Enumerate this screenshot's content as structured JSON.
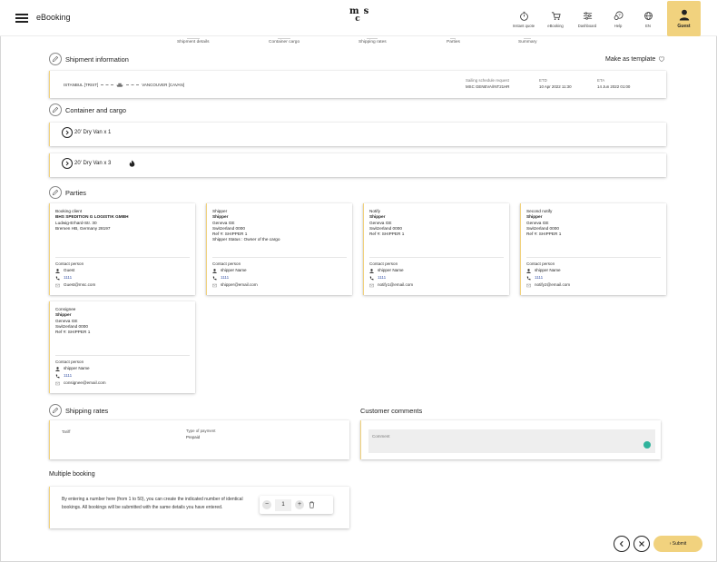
{
  "header": {
    "title": "eBooking",
    "logo_line1": "ms",
    "logo_line2": "c",
    "tools": [
      {
        "label": "Instant quote",
        "icon": "stopwatch-icon"
      },
      {
        "label": "eBooking",
        "icon": "cart-icon"
      },
      {
        "label": "Dashboard",
        "icon": "sliders-icon"
      },
      {
        "label": "Help",
        "icon": "help-chat-icon"
      },
      {
        "label": "EN",
        "icon": "globe-icon"
      }
    ],
    "user_label": "Guest"
  },
  "steps": [
    "Shipment details",
    "Container cargo",
    "Shipping rates",
    "Parties",
    "Summary"
  ],
  "shipment": {
    "heading": "Shipment information",
    "template_link": "Make as template",
    "origin": "ISTANBUL [TRIST]",
    "destination": "VANCOUVER [CAVAN]",
    "schedule_label": "Sailing schedule request",
    "schedule_value": "MSC GENEVA/INT21HR",
    "etd_label": "ETD",
    "etd_value": "10 Apr 2022 11:30",
    "eta_label": "ETA",
    "eta_value": "14 Jun 2022 01:00"
  },
  "cargo": {
    "heading": "Container and cargo",
    "items": [
      {
        "label": "20' Dry Van x 1",
        "hazard": false
      },
      {
        "label": "20' Dry Van x 3",
        "hazard": true
      }
    ]
  },
  "parties": {
    "heading": "Parties",
    "contact_label": "Contact person",
    "cards": [
      {
        "role": "Booking client",
        "name": "BHS SPEDITION G LOGISTIK GMBH",
        "lines": [
          "Ludwig-Erhard-Str. 30",
          "Bremen HB, Germany 28197",
          "",
          ""
        ],
        "contact_name": "Guest",
        "phone": "1111",
        "email": "Guest@msc.com"
      },
      {
        "role": "Shipper",
        "name": "Shipper",
        "lines": [
          "Geneva GE",
          "Switzerland 0000",
          "Ref #: SHIPPER 1",
          "Shipper Status : Owner of the cargo"
        ],
        "contact_name": "shipper Name",
        "phone": "1111",
        "email": "shipper@email.com"
      },
      {
        "role": "Notify",
        "name": "Shipper",
        "lines": [
          "Geneva GE",
          "Switzerland 0000",
          "Ref #: SHIPPER 1",
          ""
        ],
        "contact_name": "shipper Name",
        "phone": "1111",
        "email": "notify1@email.com"
      },
      {
        "role": "Second notify",
        "name": "Shipper",
        "lines": [
          "Geneva GE",
          "Switzerland 0000",
          "Ref #: SHIPPER 1",
          ""
        ],
        "contact_name": "shipper Name",
        "phone": "1111",
        "email": "notify2@email.com"
      },
      {
        "role": "Consignee",
        "name": "Shipper",
        "lines": [
          "Geneva GE",
          "Switzerland 0000",
          "Ref #: SHIPPER 1",
          ""
        ],
        "contact_name": "shipper Name",
        "phone": "1111",
        "email": "consignee@email.com"
      }
    ]
  },
  "rates": {
    "heading": "Shipping rates",
    "tariff_label": "Tariff",
    "payment_label": "Type of payment",
    "payment_value": "Prepaid"
  },
  "comments": {
    "heading": "Customer comments",
    "placeholder": "Comment"
  },
  "multi": {
    "heading": "Multiple booking",
    "text": "By entering a number here (from 1 to 50), you can create the indicated number of identical bookings. All bookings will be submitted with the same details you have entered.",
    "minus": "−",
    "value": "1",
    "plus": "+"
  },
  "footer": {
    "submit_label": "› Submit"
  },
  "colors": {
    "accent": "#f1d27e",
    "link": "#3a56a8"
  }
}
